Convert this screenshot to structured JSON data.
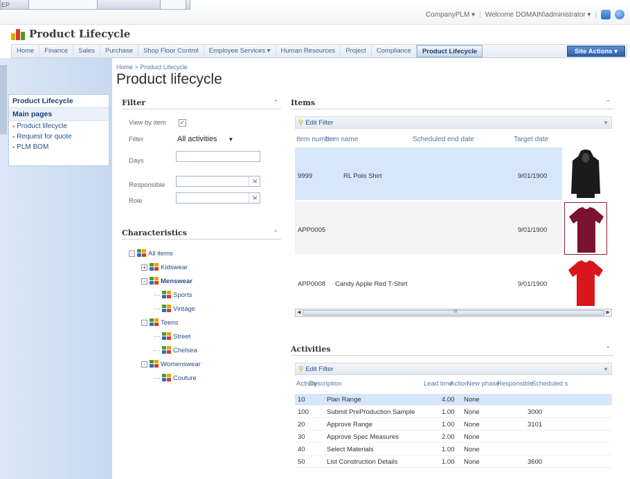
{
  "topbar": {
    "corner_label": "EP",
    "site_menu": "CompanyPLM ▾",
    "welcome": "Welcome DOMAIN\\administrator ▾"
  },
  "site": {
    "title": "Product Lifecycle"
  },
  "nav": {
    "items": [
      "Home",
      "Finance",
      "Sales",
      "Purchase",
      "Shop Floor Control",
      "Employee Services ▾",
      "Human Resources",
      "Project",
      "Compliance",
      "Product Lifecycle"
    ],
    "active_index": 9,
    "site_actions": "Site Actions ▾"
  },
  "quick_launch": {
    "heading": "Product Lifecycle",
    "section": "Main pages",
    "links": [
      "Product lifecycle",
      "Request for quote",
      "PLM BOM"
    ]
  },
  "breadcrumb": "Home > Product Lifecycle",
  "page_title": "Product lifecycle",
  "filter": {
    "title": "Filter",
    "view_by_item_label": "View by item",
    "view_by_item_checked": true,
    "filter_label": "Filter",
    "filter_value": "All activities",
    "days_label": "Days",
    "responsible_label": "Responsible",
    "role_label": "Role"
  },
  "characteristics": {
    "title": "Characteristics",
    "tree": [
      {
        "label": "All items",
        "level": 0,
        "exp": "-",
        "bold": false
      },
      {
        "label": "Kidswear",
        "level": 1,
        "exp": "+",
        "bold": false
      },
      {
        "label": "Menswear",
        "level": 1,
        "exp": "-",
        "bold": true
      },
      {
        "label": "Sports",
        "level": 2,
        "exp": "",
        "bold": false
      },
      {
        "label": "Vintage",
        "level": 2,
        "exp": "",
        "bold": false
      },
      {
        "label": "Teens",
        "level": 1,
        "exp": "-",
        "bold": false
      },
      {
        "label": "Street",
        "level": 2,
        "exp": "",
        "bold": false
      },
      {
        "label": "Chelsea",
        "level": 2,
        "exp": "",
        "bold": false
      },
      {
        "label": "Womenswear",
        "level": 1,
        "exp": "-",
        "bold": false
      },
      {
        "label": "Couture",
        "level": 2,
        "exp": "",
        "bold": false
      }
    ]
  },
  "items": {
    "title": "Items",
    "edit_filter": "Edit Filter",
    "columns": [
      "Item number",
      "Item name",
      "Scheduled end date",
      "Target date"
    ],
    "rows": [
      {
        "number": "9999",
        "name": "RL Polo Shirt",
        "target": "9/01/1900",
        "selected": true,
        "garment": "hoodie",
        "color": "#1b1b1b"
      },
      {
        "number": "APP0005",
        "name": "",
        "target": "9/01/1900",
        "selected": false,
        "garment": "tshirt",
        "color": "#7a1230"
      },
      {
        "number": "APP0008",
        "name": "Candy Apple Red T-Shirt",
        "target": "9/01/1900",
        "selected": false,
        "garment": "tshirt",
        "color": "#d8161b"
      }
    ],
    "scroll_mid": "III"
  },
  "activities": {
    "title": "Activities",
    "edit_filter": "Edit Filter",
    "columns": [
      "Activity",
      "Description",
      "Lead time",
      "Action",
      "New phase",
      "Responsible",
      "Scheduled s"
    ],
    "rows": [
      {
        "activity": "10",
        "description": "Plan Range",
        "lead": "4.00",
        "action": "None",
        "responsible": "",
        "selected": true
      },
      {
        "activity": "100",
        "description": "Submit PreProduction Sample",
        "lead": "1.00",
        "action": "None",
        "responsible": "3000",
        "selected": false
      },
      {
        "activity": "20",
        "description": "Approve Range",
        "lead": "1.00",
        "action": "None",
        "responsible": "3101",
        "selected": false
      },
      {
        "activity": "30",
        "description": "Approve Spec Measures",
        "lead": "2.00",
        "action": "None",
        "responsible": "",
        "selected": false
      },
      {
        "activity": "40",
        "description": "Select Materials",
        "lead": "1.00",
        "action": "None",
        "responsible": "",
        "selected": false
      },
      {
        "activity": "50",
        "description": "List Construction Details",
        "lead": "1.00",
        "action": "None",
        "responsible": "3600",
        "selected": false
      }
    ]
  },
  "colors": {
    "accent": "#2f5fa8",
    "link": "#2a4d85",
    "selected_row": "#d6e6fb"
  }
}
